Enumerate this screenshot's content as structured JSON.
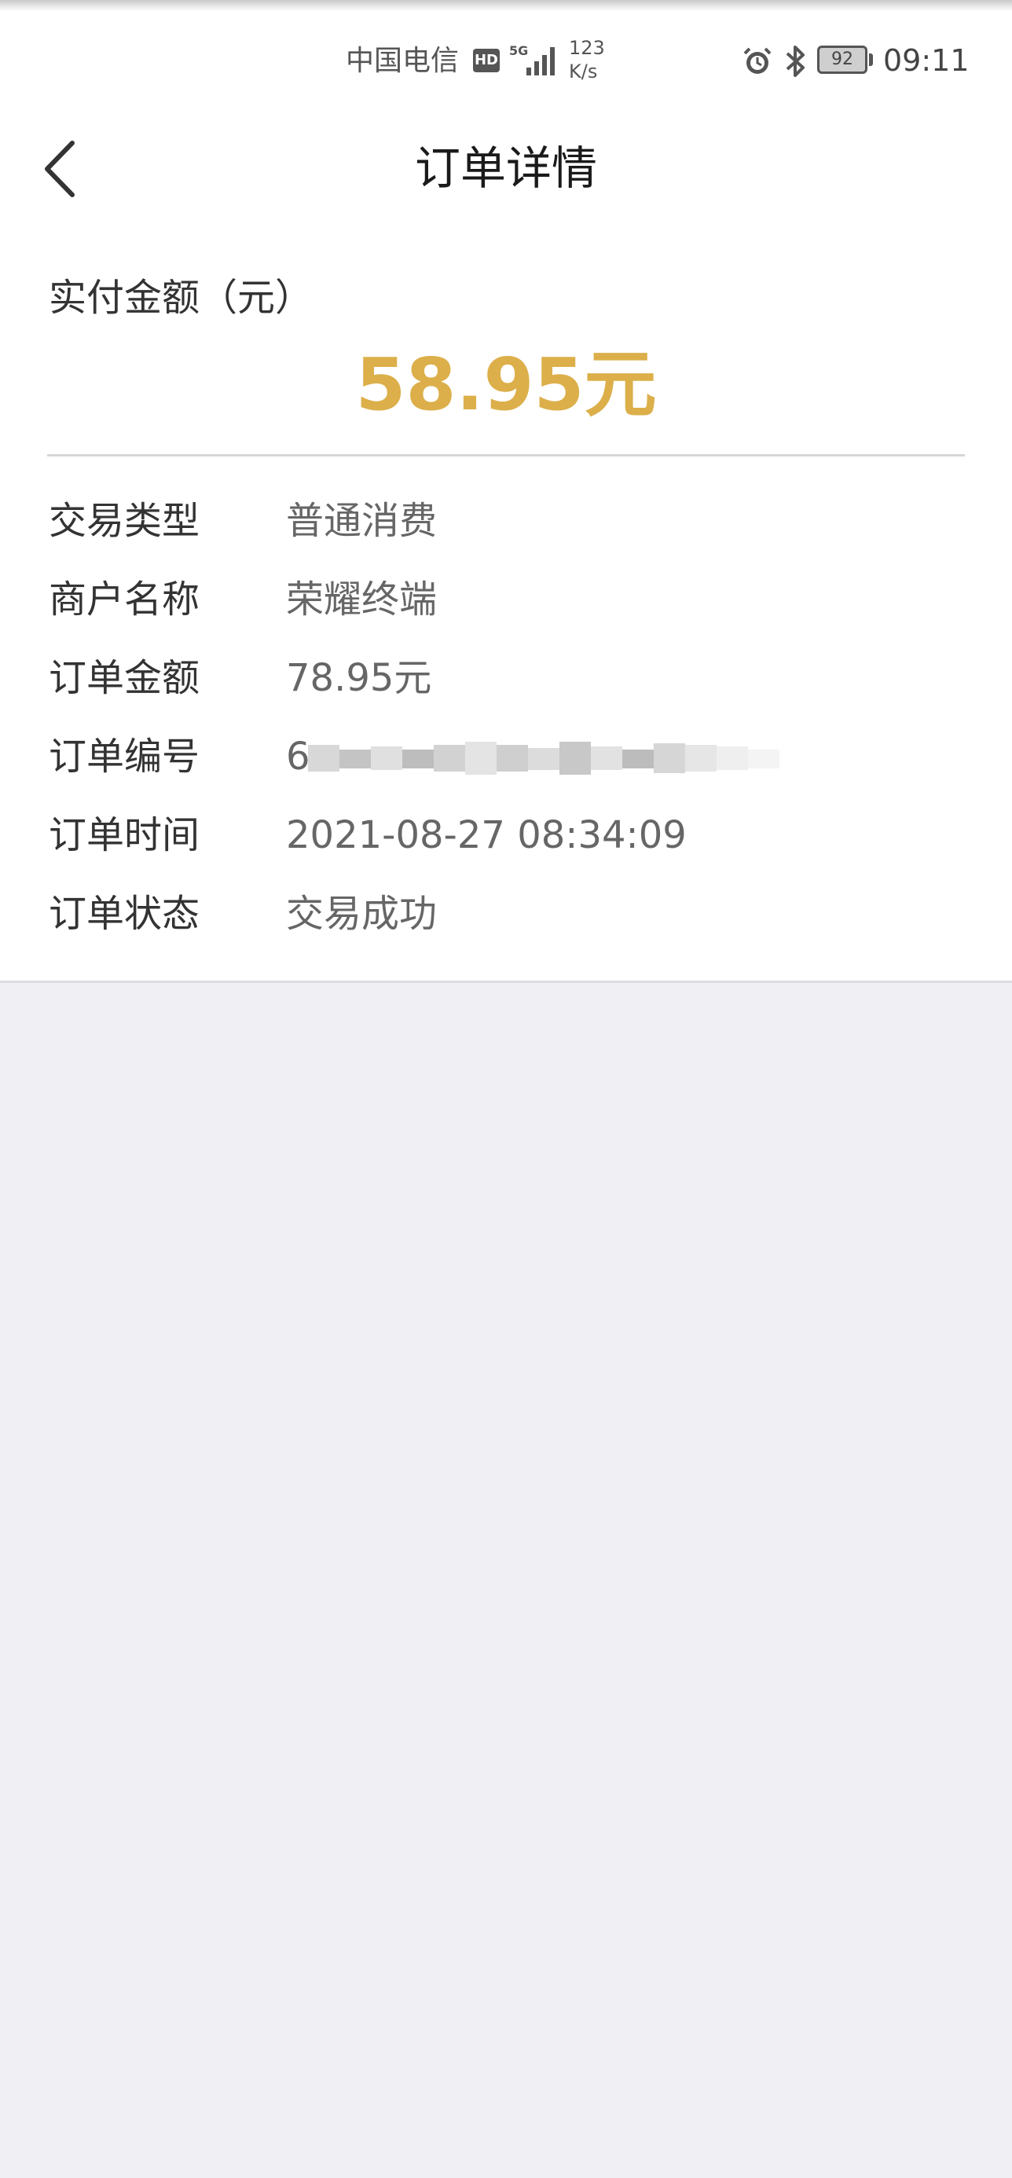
{
  "status_bar": {
    "carrier": "中国电信",
    "hd": "HD",
    "network": "5G",
    "speed_value": "123",
    "speed_unit": "K/s",
    "battery": "92",
    "time": "09:11"
  },
  "header": {
    "title": "订单详情"
  },
  "amount": {
    "label": "实付金额（元）",
    "value": "58.95元",
    "color": "#dcaf4a"
  },
  "details": [
    {
      "label": "交易类型",
      "value": "普通消费"
    },
    {
      "label": "商户名称",
      "value": "荣耀终端"
    },
    {
      "label": "订单金额",
      "value": "78.95元"
    },
    {
      "label": "订单编号",
      "value": "6"
    },
    {
      "label": "订单时间",
      "value": "2021-08-27 08:34:09"
    },
    {
      "label": "订单状态",
      "value": "交易成功"
    }
  ],
  "icons": {
    "back": "chevron-left-icon",
    "alarm": "alarm-icon",
    "bluetooth": "bluetooth-icon",
    "signal": "signal-icon"
  }
}
